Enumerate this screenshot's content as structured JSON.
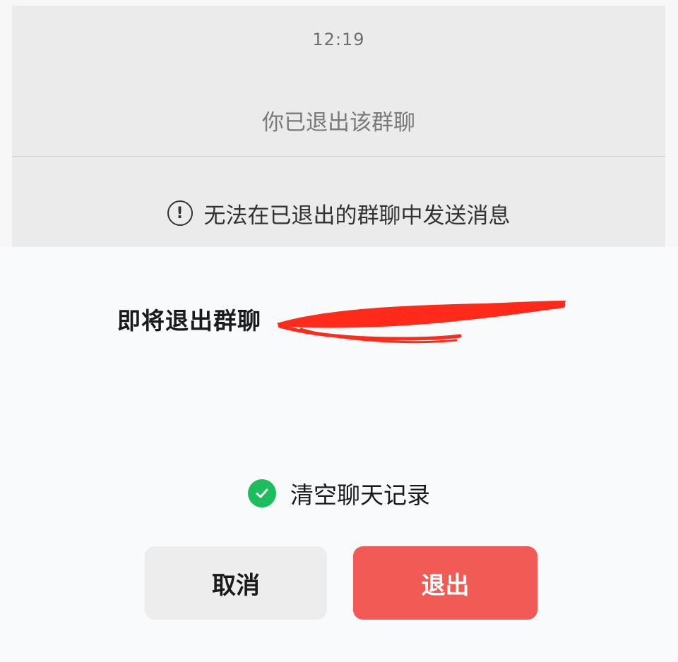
{
  "chat": {
    "time": "12:19",
    "system_message": "你已退出该群聊",
    "notice": "无法在已退出的群聊中发送消息",
    "notice_icon": "exclamation-circle-icon"
  },
  "dialog": {
    "title": "即将退出群聊",
    "clear_history_label": "清空聊天记录",
    "clear_history_checked": true,
    "cancel_label": "取消",
    "exit_label": "退出"
  },
  "colors": {
    "accent_green": "#1bbd5c",
    "danger_red": "#f25a55",
    "redaction_red": "#ff2a1a"
  }
}
